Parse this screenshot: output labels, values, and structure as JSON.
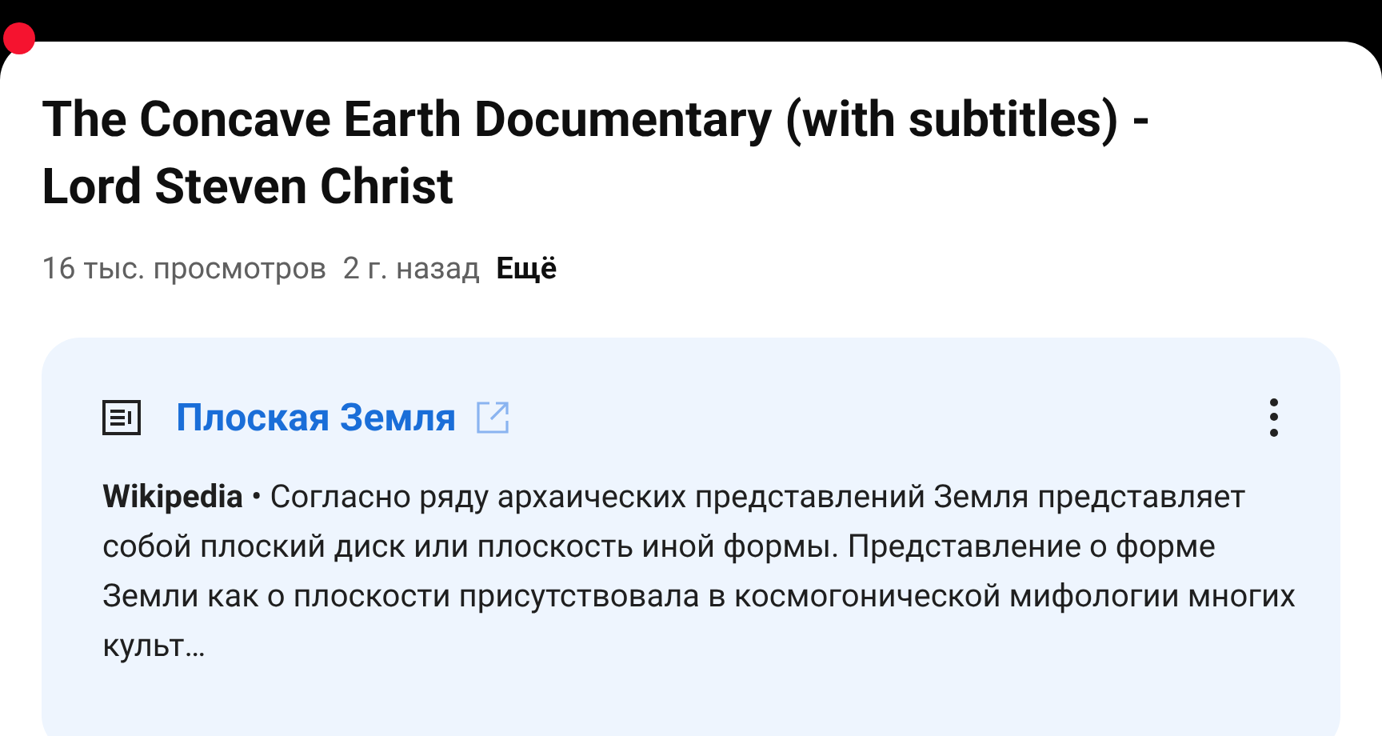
{
  "video": {
    "title": "The Concave Earth Documentary (with subtitles) - Lord Steven Christ",
    "views": "16 тыс. просмотров",
    "age": "2 г. назад",
    "more": "Ещё"
  },
  "card": {
    "title": "Плоская Земля",
    "snippet": "**Wikipedia** • Согласно ряду архаических представлений Земля представляет собой плоский диск или плоскость иной формы. Представление о форме Земли как о плоскости присутствовала в космогонической мифологии многих культ…"
  }
}
